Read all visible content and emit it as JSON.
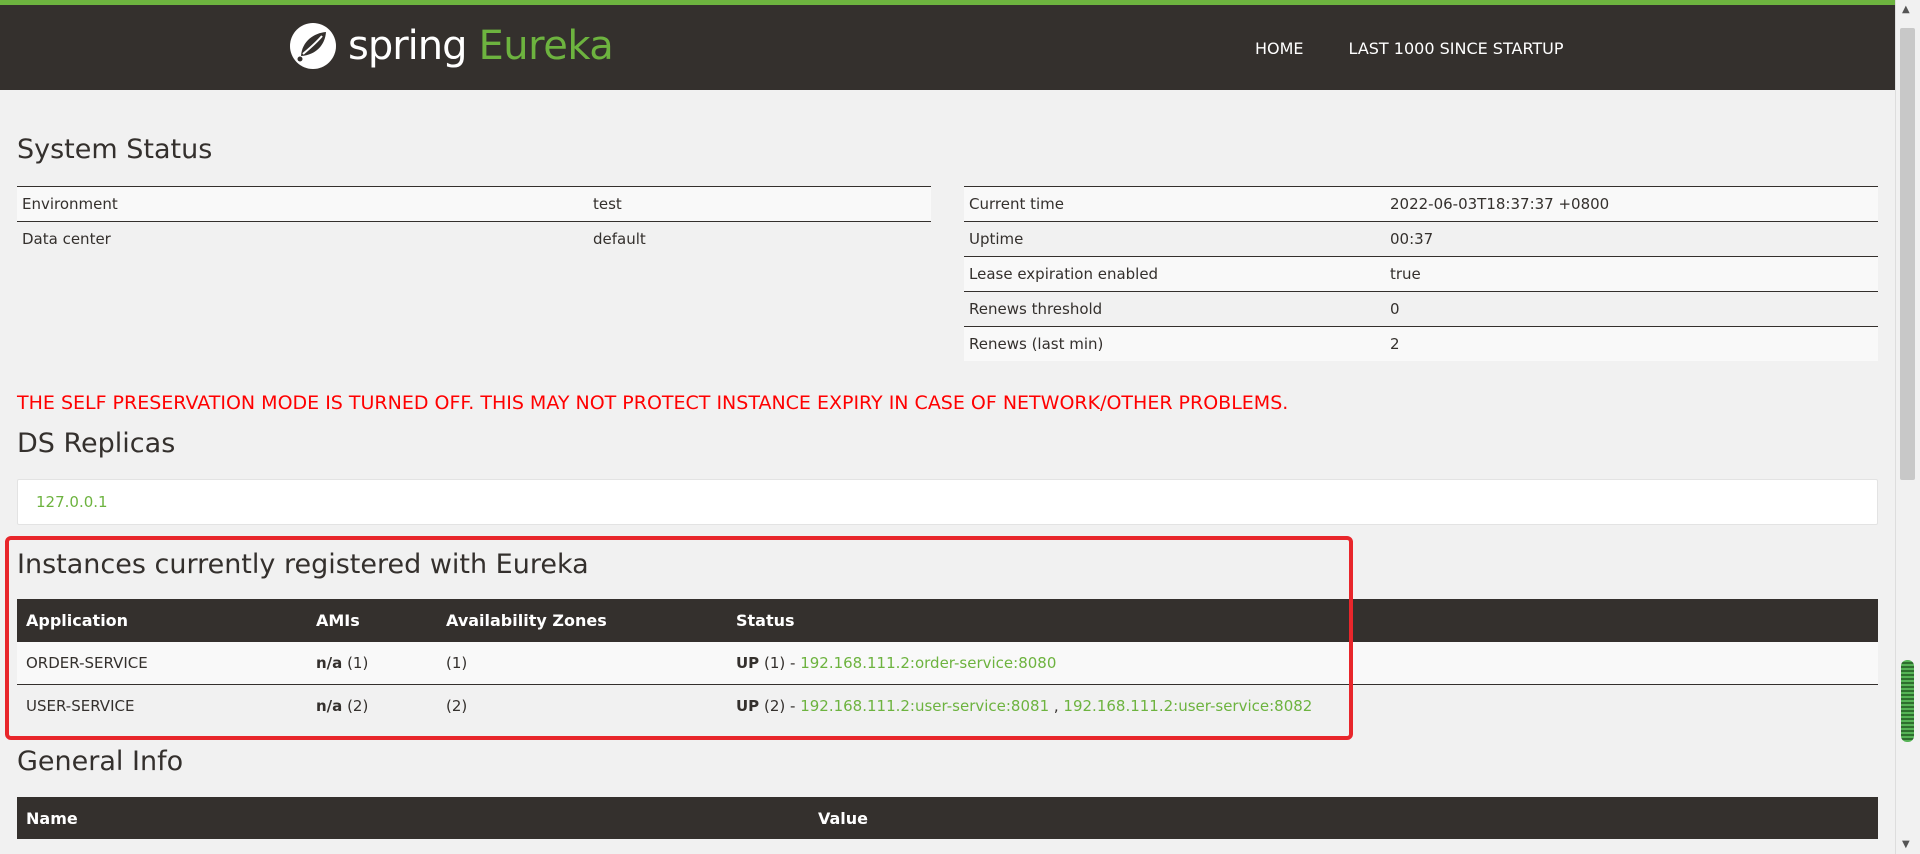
{
  "header": {
    "logo_spring": "spring",
    "logo_eureka": "Eureka",
    "nav": [
      "HOME",
      "LAST 1000 SINCE STARTUP"
    ]
  },
  "system_status": {
    "title": "System Status",
    "left": [
      {
        "name": "Environment",
        "value": "test"
      },
      {
        "name": "Data center",
        "value": "default"
      }
    ],
    "right": [
      {
        "name": "Current time",
        "value": "2022-06-03T18:37:37 +0800"
      },
      {
        "name": "Uptime",
        "value": "00:37"
      },
      {
        "name": "Lease expiration enabled",
        "value": "true"
      },
      {
        "name": "Renews threshold",
        "value": "0"
      },
      {
        "name": "Renews (last min)",
        "value": "2"
      }
    ]
  },
  "warning": "THE SELF PRESERVATION MODE IS TURNED OFF. THIS MAY NOT PROTECT INSTANCE EXPIRY IN CASE OF NETWORK/OTHER PROBLEMS.",
  "ds_replicas": {
    "title": "DS Replicas",
    "items": [
      "127.0.0.1"
    ]
  },
  "instances": {
    "title": "Instances currently registered with Eureka",
    "columns": [
      "Application",
      "AMIs",
      "Availability Zones",
      "Status"
    ],
    "rows": [
      {
        "application": "ORDER-SERVICE",
        "ami_label": "n/a",
        "ami_count": "(1)",
        "zones": "(1)",
        "status": "UP",
        "status_count": "(1) -",
        "links": [
          "192.168.111.2:order-service:8080"
        ]
      },
      {
        "application": "USER-SERVICE",
        "ami_label": "n/a",
        "ami_count": "(2)",
        "zones": "(2)",
        "status": "UP",
        "status_count": "(2) -",
        "links": [
          "192.168.111.2:user-service:8081",
          "192.168.111.2:user-service:8082"
        ]
      }
    ]
  },
  "general_info": {
    "title": "General Info",
    "columns": [
      "Name",
      "Value"
    ]
  },
  "colors": {
    "brand_green": "#6db33f",
    "header_bg": "#34302d",
    "warning_red": "#ff0000",
    "highlight_red": "#e8262b"
  }
}
